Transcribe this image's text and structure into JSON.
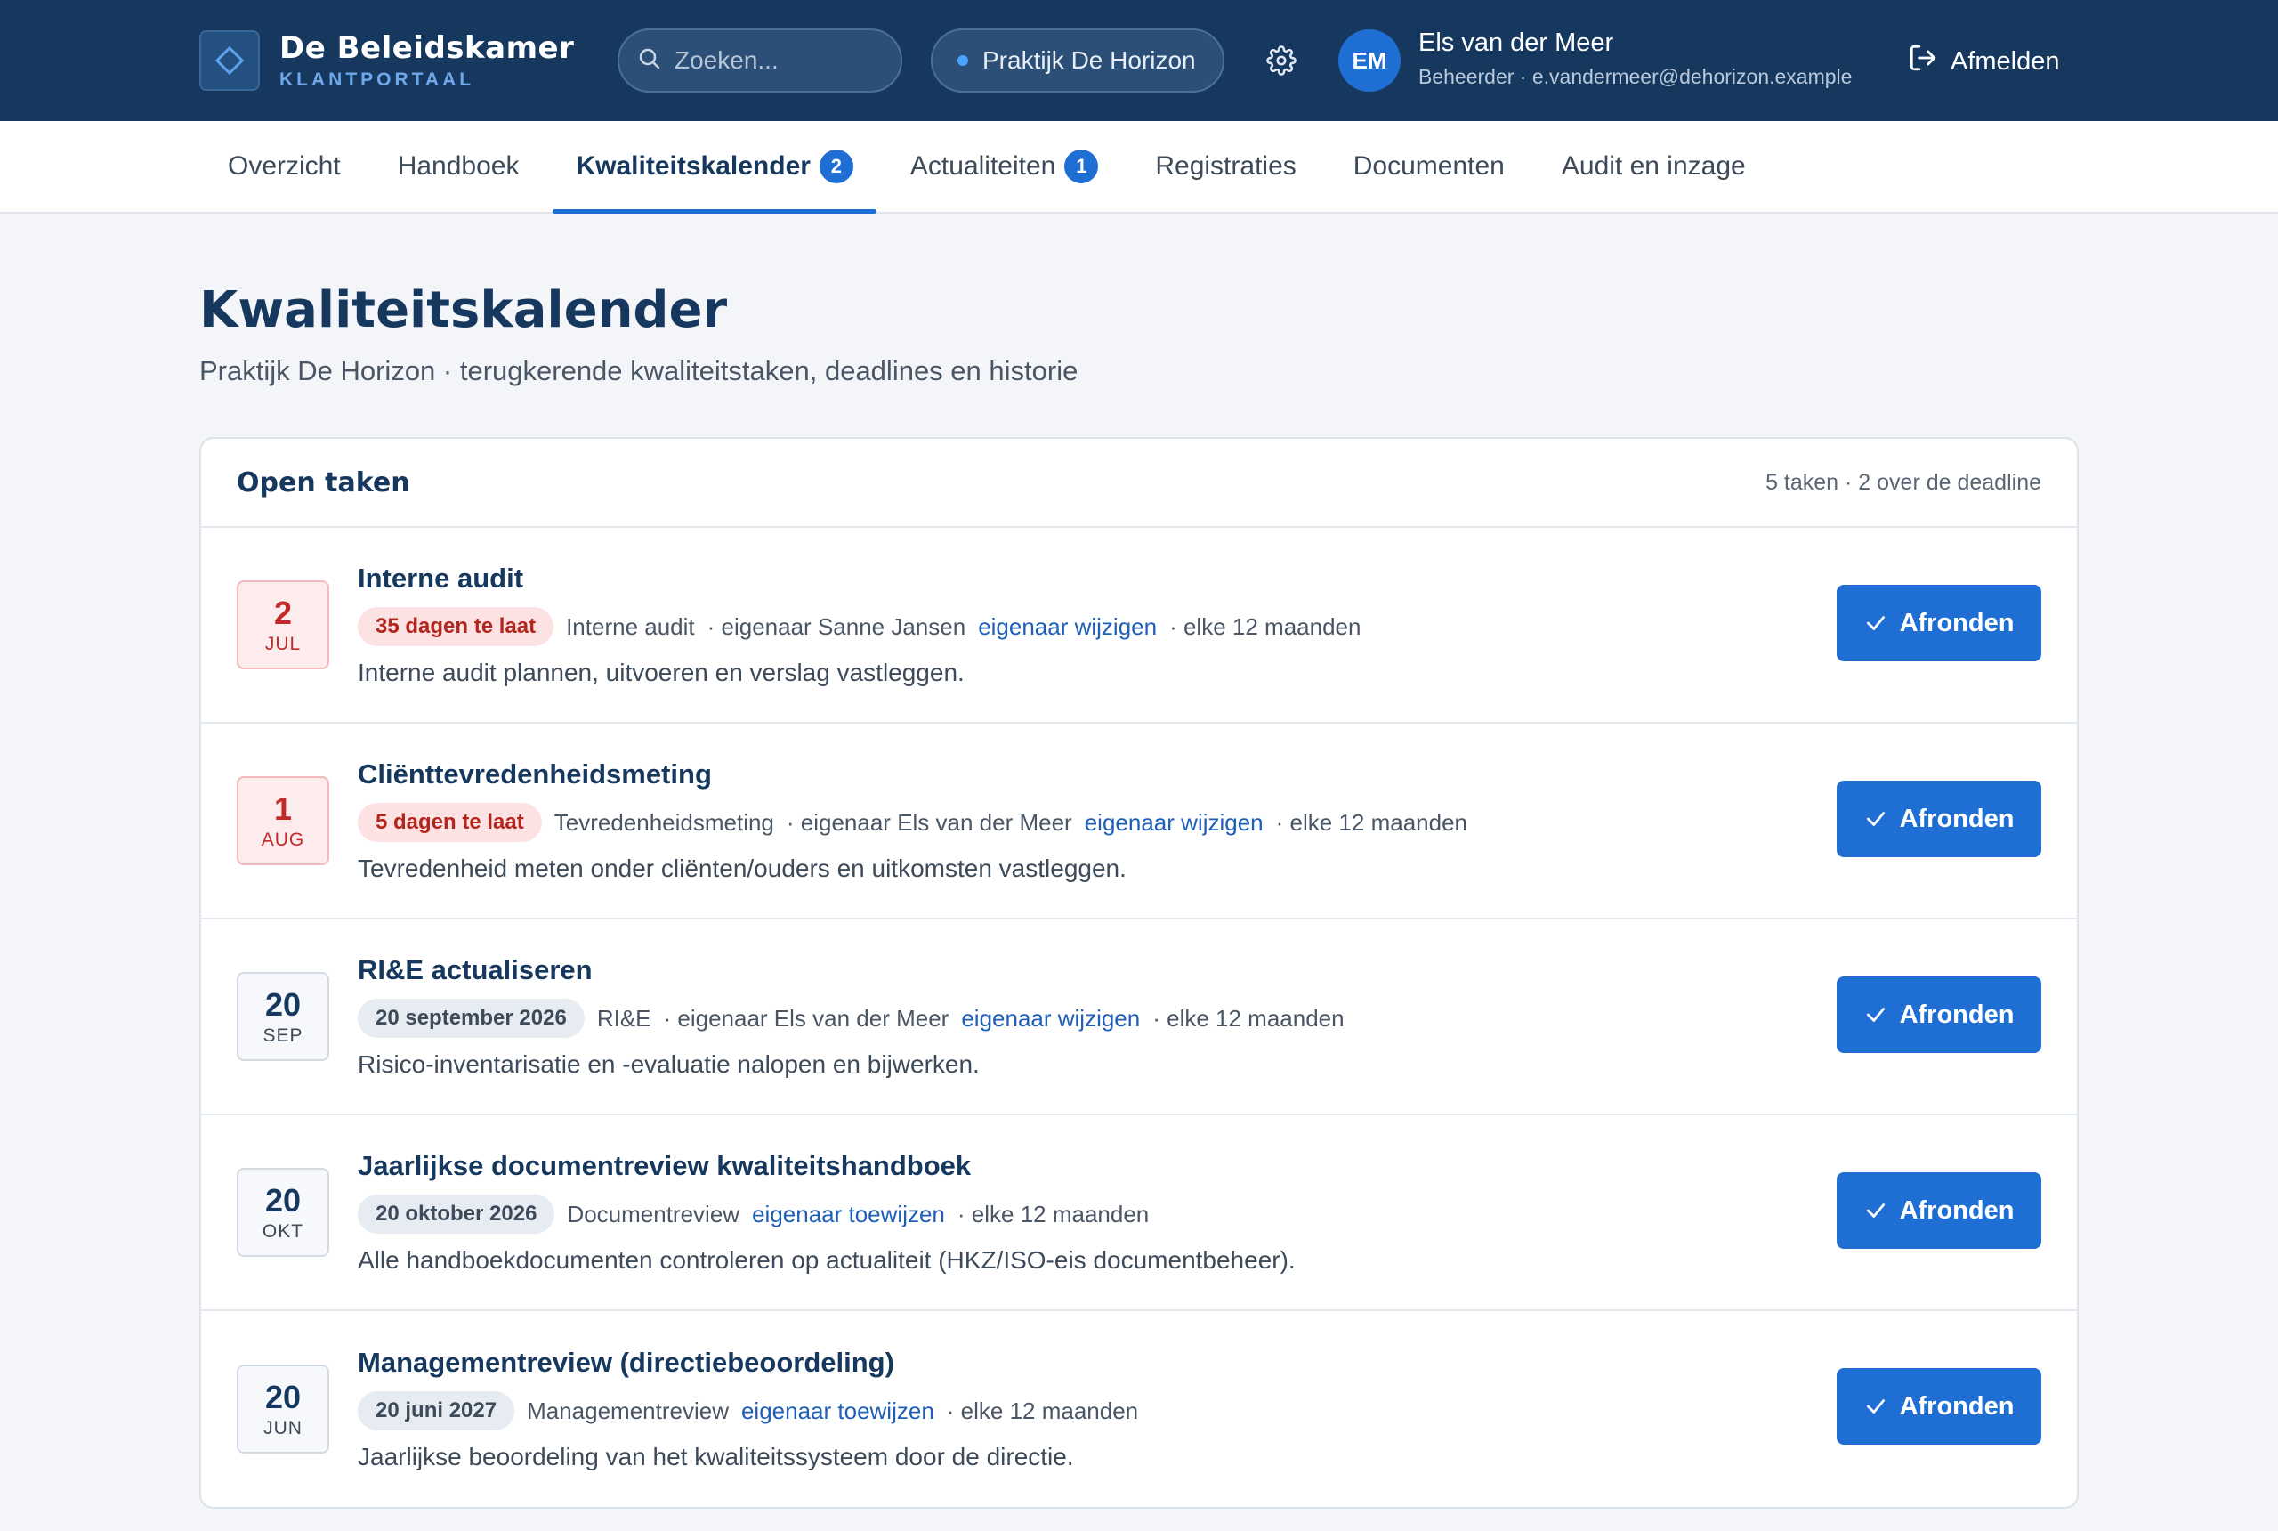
{
  "app": {
    "name": "De Beleidskamer",
    "subtitle": "KLANTPORTAAL",
    "logo_icon": "diamond-logo-icon"
  },
  "header": {
    "search_placeholder": "Zoeken...",
    "practice_label": "Praktijk De Horizon",
    "user": {
      "initials": "EM",
      "name": "Els van der Meer",
      "role_email": "Beheerder · e.vandermeer@dehorizon.example"
    },
    "logout_label": "Afmelden"
  },
  "tabs": [
    {
      "label": "Overzicht",
      "badge": null,
      "active": false
    },
    {
      "label": "Handboek",
      "badge": null,
      "active": false
    },
    {
      "label": "Kwaliteitskalender",
      "badge": "2",
      "active": true
    },
    {
      "label": "Actualiteiten",
      "badge": "1",
      "active": false
    },
    {
      "label": "Registraties",
      "badge": null,
      "active": false
    },
    {
      "label": "Documenten",
      "badge": null,
      "active": false
    },
    {
      "label": "Audit en inzage",
      "badge": null,
      "active": false
    }
  ],
  "page": {
    "title": "Kwaliteitskalender",
    "subtitle": "Praktijk De Horizon · terugkerende kwaliteitstaken, deadlines en historie"
  },
  "card": {
    "title": "Open taken",
    "meta": "5 taken · 2 over de deadline"
  },
  "tasks": [
    {
      "day": "2",
      "month": "JUL",
      "late": true,
      "title": "Interne audit",
      "pill": "35 dagen te laat",
      "category": "Interne audit",
      "owner": "· eigenaar Sanne Jansen",
      "owner_link": "eigenaar wijzigen",
      "frequency": "· elke 12 maanden",
      "description": "Interne audit plannen, uitvoeren en verslag vastleggen.",
      "button": "Afronden"
    },
    {
      "day": "1",
      "month": "AUG",
      "late": true,
      "title": "Cliënttevredenheidsmeting",
      "pill": "5 dagen te laat",
      "category": "Tevredenheidsmeting",
      "owner": "· eigenaar Els van der Meer",
      "owner_link": "eigenaar wijzigen",
      "frequency": "· elke 12 maanden",
      "description": "Tevredenheid meten onder cliënten/ouders en uitkomsten vastleggen.",
      "button": "Afronden"
    },
    {
      "day": "20",
      "month": "SEP",
      "late": false,
      "title": "RI&E actualiseren",
      "pill": "20 september 2026",
      "category": "RI&E",
      "owner": "· eigenaar Els van der Meer",
      "owner_link": "eigenaar wijzigen",
      "frequency": "· elke 12 maanden",
      "description": "Risico-inventarisatie en -evaluatie nalopen en bijwerken.",
      "button": "Afronden"
    },
    {
      "day": "20",
      "month": "OKT",
      "late": false,
      "title": "Jaarlijkse documentreview kwaliteitshandboek",
      "pill": "20 oktober 2026",
      "category": "Documentreview",
      "owner": "",
      "owner_link": "eigenaar toewijzen",
      "frequency": "· elke 12 maanden",
      "description": "Alle handboekdocumenten controleren op actualiteit (HKZ/ISO-eis documentbeheer).",
      "button": "Afronden"
    },
    {
      "day": "20",
      "month": "JUN",
      "late": false,
      "title": "Managementreview (directiebeoordeling)",
      "pill": "20 juni 2027",
      "category": "Managementreview",
      "owner": "",
      "owner_link": "eigenaar toewijzen",
      "frequency": "· elke 12 maanden",
      "description": "Jaarlijkse beoordeling van het kwaliteitssysteem door de directie.",
      "button": "Afronden"
    }
  ],
  "colors": {
    "header_bg": "#16385f",
    "accent": "#1f6ed4",
    "late_red": "#c22a2a"
  }
}
